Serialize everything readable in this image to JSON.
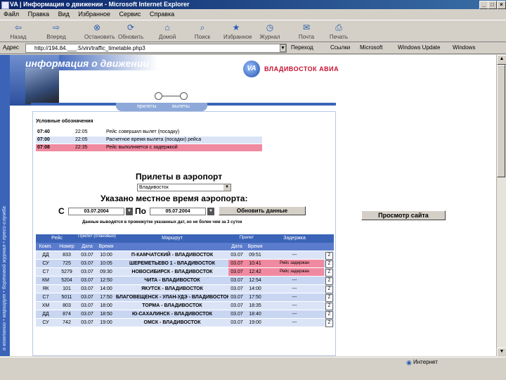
{
  "window": {
    "title": "VA | Информация о движении - Microsoft Internet Explorer"
  },
  "menu": [
    "Файл",
    "Правка",
    "Вид",
    "Избранное",
    "Сервис",
    "Справка"
  ],
  "toolbar": [
    {
      "label": "Назад",
      "icon": "back-arrow-icon",
      "glyph": "⇦"
    },
    {
      "label": "Вперед",
      "icon": "forward-arrow-icon",
      "glyph": "⇨"
    },
    {
      "label": "Остановить",
      "icon": "stop-icon",
      "glyph": "⊗"
    },
    {
      "label": "Обновить",
      "icon": "refresh-icon",
      "glyph": "⟳"
    },
    {
      "label": "Домой",
      "icon": "home-icon",
      "glyph": "⌂"
    },
    {
      "label": "Поиск",
      "icon": "search-icon",
      "glyph": "⌕"
    },
    {
      "label": "Избранное",
      "icon": "favorites-icon",
      "glyph": "★"
    },
    {
      "label": "Журнал",
      "icon": "history-icon",
      "glyph": "◷"
    },
    {
      "label": "Почта",
      "icon": "mail-icon",
      "glyph": "✉"
    },
    {
      "label": "Печать",
      "icon": "print-icon",
      "glyph": "⎙"
    }
  ],
  "address": {
    "label": "Адрес",
    "url": "http://194.84.___.5/vin/traffic_timetable.php3",
    "go": "Переход",
    "links": [
      "Ссылки",
      "Microsoft",
      "Windows Update",
      "Windows"
    ]
  },
  "page": {
    "header_title": "информация о движении",
    "logo_text": "VA",
    "brand": "ВЛАДИВОСТОК АВИА",
    "vertical_text": "о компании • маршрут • бортовой журнал • пресс-служба",
    "tabs": [
      "прилеты",
      "вылеты"
    ],
    "legend_title": "Условные обозначения",
    "legend": [
      {
        "code": "07:40",
        "time": "22:05",
        "desc": "Рейс совершил вылет (посадку)",
        "color": "#ffffff"
      },
      {
        "code": "07:00",
        "time": "22:05",
        "desc": "Расчетное время вылета (посадки) рейса",
        "color": "#dbe4f7"
      },
      {
        "code": "07:08",
        "time": "22:35",
        "desc": "Рейс выполняется с задержкой",
        "color": "#f08aa0"
      }
    ],
    "arrivals_title": "Прилеты в аэропорт",
    "airport": "Владивосток",
    "local_time_title": "Указано местное время аэропорта:",
    "from_label": "С",
    "from_date": "03.07.2004",
    "to_label": "По",
    "to_date": "05.07.2004",
    "refresh": "Обновить данные",
    "note": "Данные выводятся в промежутке указанных дат, но не более чем за 3 суток",
    "view_site": "Просмотр сайта"
  },
  "table": {
    "headers": {
      "flight": "Рейс",
      "arrival": "Прилет (плановый)",
      "route": "Маршрут",
      "actual": "Прилет",
      "delay": "Задержка",
      "company": "Комп.",
      "number": "Номер",
      "date": "Дата",
      "time": "Время",
      "actual_date": "Дата",
      "actual_time": "Время"
    },
    "rows": [
      {
        "company": "ДД",
        "number": "833",
        "date": "03.07",
        "time": "10:00",
        "route": "П-КАМЧАТСКИЙ - ВЛАДИВОСТОК",
        "actual_date": "03.07",
        "actual_time": "09:51",
        "delay": "---",
        "delayed": false
      },
      {
        "company": "СУ",
        "number": "725",
        "date": "03.07",
        "time": "10:05",
        "route": "ШЕРЕМЕТЬЕВО 1 - ВЛАДИВОСТОК",
        "actual_date": "03.07",
        "actual_time": "10:41",
        "delay": "Рейс задержан",
        "delayed": true
      },
      {
        "company": "С7",
        "number": "5279",
        "date": "03.07",
        "time": "09:30",
        "route": "НОВОСИБИРСК - ВЛАДИВОСТОК",
        "actual_date": "03.07",
        "actual_time": "12:42",
        "delay": "Рейс задержан",
        "delayed": true
      },
      {
        "company": "КМ",
        "number": "5204",
        "date": "03.07",
        "time": "12:50",
        "route": "ЧИТА - ВЛАДИВОСТОК",
        "actual_date": "03.07",
        "actual_time": "12:54",
        "delay": "---",
        "delayed": false
      },
      {
        "company": "ЯК",
        "number": "101",
        "date": "03.07",
        "time": "14:00",
        "route": "ЯКУТСК - ВЛАДИВОСТОК",
        "actual_date": "03.07",
        "actual_time": "14:00",
        "delay": "---",
        "delayed": false
      },
      {
        "company": "С7",
        "number": "5011",
        "date": "03.07",
        "time": "17:50",
        "route": "БЛАГОВЕЩЕНСК - УЛАН-УДЭ - ВЛАДИВОСТОК",
        "actual_date": "03.07",
        "actual_time": "17:50",
        "delay": "---",
        "delayed": false
      },
      {
        "company": "ХМ",
        "number": "803",
        "date": "03.07",
        "time": "18:00",
        "route": "ТОРМА - ВЛАДИВОСТОК",
        "actual_date": "03.07",
        "actual_time": "18:35",
        "delay": "---",
        "delayed": false
      },
      {
        "company": "ДД",
        "number": "874",
        "date": "03.07",
        "time": "18:50",
        "route": "Ю-САХАЛИНСК - ВЛАДИВОСТОК",
        "actual_date": "03.07",
        "actual_time": "18:40",
        "delay": "---",
        "delayed": false
      },
      {
        "company": "СУ",
        "number": "742",
        "date": "03.07",
        "time": "19:00",
        "route": "ОМСК - ВЛАДИВОСТОК",
        "actual_date": "03.07",
        "actual_time": "19:00",
        "delay": "---",
        "delayed": false
      }
    ]
  },
  "status": {
    "zone": "Интернет"
  }
}
